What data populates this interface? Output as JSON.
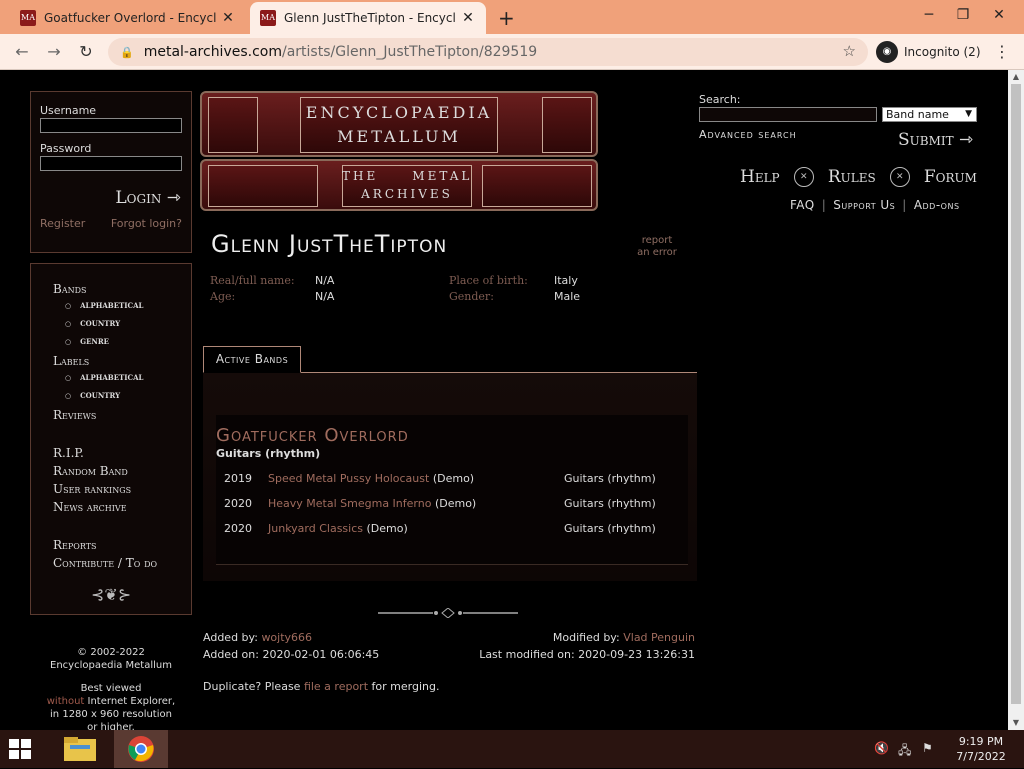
{
  "browser": {
    "tabs": [
      {
        "title": "Goatfucker Overlord - Encyclopaedia",
        "favicon": "MA"
      },
      {
        "title": "Glenn JustTheTipton - Encyclopaedia",
        "favicon": "MA"
      }
    ],
    "url_host": "metal-archives.com",
    "url_path": "/artists/Glenn_JustTheTipton/829519",
    "incognito_label": "Incognito (2)"
  },
  "login": {
    "username_label": "Username",
    "password_label": "Password",
    "login_button": "Login",
    "register": "Register",
    "forgot": "Forgot login?"
  },
  "nav": {
    "bands": "Bands",
    "bands_alpha": "alphabetical",
    "bands_country": "country",
    "bands_genre": "genre",
    "labels": "Labels",
    "labels_alpha": "alphabetical",
    "labels_country": "country",
    "reviews": "Reviews",
    "rip": "R.I.P.",
    "random": "Random Band",
    "rankings": "User rankings",
    "news": "News archive",
    "reports": "Reports",
    "contribute": "Contribute / To do"
  },
  "sidefoot": {
    "copyright": "© 2002-2022",
    "site": "Encyclopaedia Metallum",
    "best": "Best viewed",
    "without": "without",
    "ie": " Internet Explorer,",
    "res": "in 1280 x 960 resolution",
    "higher": "or higher."
  },
  "logo": {
    "line1": "ENCYCLOPAEDIA",
    "line2": "METALLUM",
    "line3": "THE     METAL",
    "line4": "ARCHIVES"
  },
  "search": {
    "label": "Search:",
    "select_value": "Band name",
    "advanced": "Advanced search",
    "submit": "Submit"
  },
  "mainnav": {
    "help": "Help",
    "rules": "Rules",
    "forum": "Forum"
  },
  "subnav": {
    "faq": "FAQ",
    "support": "Support Us",
    "addons": "Add-ons"
  },
  "artist": {
    "name": "Glenn JustTheTipton",
    "report1": "report",
    "report2": "an error",
    "real_name_label": "Real/full name:",
    "real_name": "N/A",
    "age_label": "Age:",
    "age": "N/A",
    "birth_label": "Place of birth:",
    "birth": "Italy",
    "gender_label": "Gender:",
    "gender": "Male"
  },
  "tabs": {
    "active_bands": "Active Bands"
  },
  "band": {
    "name": "Goatfucker Overlord",
    "role": "Guitars (rhythm)",
    "releases": [
      {
        "year": "2019",
        "title": "Speed Metal Pussy Holocaust",
        "type": " (Demo)",
        "role": "Guitars (rhythm)"
      },
      {
        "year": "2020",
        "title": "Heavy Metal Smegma Inferno",
        "type": " (Demo)",
        "role": "Guitars (rhythm)"
      },
      {
        "year": "2020",
        "title": "Junkyard Classics",
        "type": " (Demo)",
        "role": "Guitars (rhythm)"
      }
    ]
  },
  "meta": {
    "added_by_label": "Added by: ",
    "added_by": "wojty666",
    "added_on_label": "Added on: ",
    "added_on": "2020-02-01 06:06:45",
    "modified_by_label": "Modified by: ",
    "modified_by": "Vlad Penguin",
    "last_modified_label": "Last modified on: ",
    "last_modified": "2020-09-23 13:26:31",
    "dup_prefix": "Duplicate? Please ",
    "dup_link": "file a report",
    "dup_suffix": " for merging."
  },
  "taskbar": {
    "time": "9:19 PM",
    "date": "7/7/2022"
  }
}
